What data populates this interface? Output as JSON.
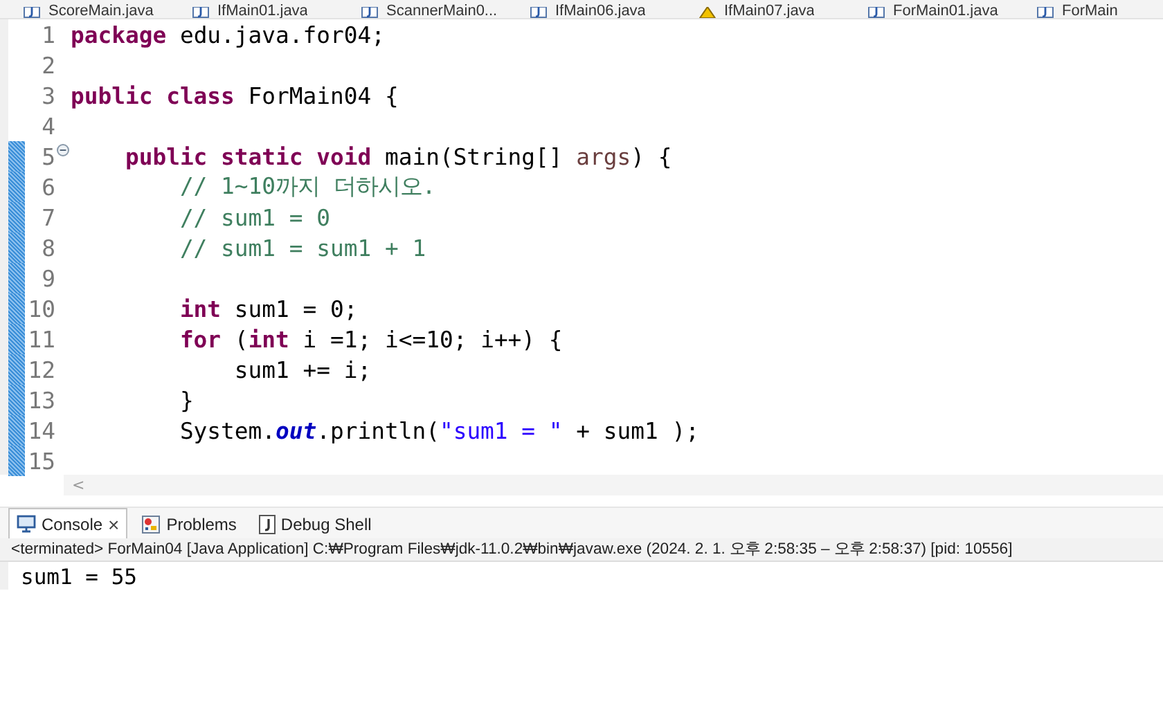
{
  "editor_tabs": [
    {
      "label": "ScoreMain.java",
      "kind": "java"
    },
    {
      "label": "IfMain01.java",
      "kind": "java"
    },
    {
      "label": "ScannerMain0...",
      "kind": "java"
    },
    {
      "label": "IfMain06.java",
      "kind": "java"
    },
    {
      "label": "IfMain07.java",
      "kind": "warning"
    },
    {
      "label": "ForMain01.java",
      "kind": "java"
    },
    {
      "label": "ForMain",
      "kind": "java"
    }
  ],
  "code_lines": [
    {
      "number": "1",
      "changed": false,
      "fold": false,
      "tokens": [
        {
          "kind": "keyword",
          "text": "package"
        },
        {
          "kind": "plain",
          "text": " edu.java.for04;"
        }
      ]
    },
    {
      "number": "2",
      "changed": false,
      "fold": false
    },
    {
      "number": "3",
      "changed": false,
      "fold": false,
      "tokens": [
        {
          "kind": "keyword",
          "text": "public class"
        },
        {
          "kind": "plain",
          "text": " ForMain04 {"
        }
      ]
    },
    {
      "number": "4",
      "changed": false,
      "fold": false
    },
    {
      "number": "5",
      "changed": true,
      "fold": true,
      "tokens": [
        {
          "kind": "keyword",
          "text": "    public static void"
        },
        {
          "kind": "plain",
          "text": " main(String[] "
        },
        {
          "kind": "variable",
          "text": "args"
        },
        {
          "kind": "plain",
          "text": ") {"
        }
      ]
    },
    {
      "number": "6",
      "changed": true,
      "fold": false,
      "tokens": [
        {
          "kind": "comment",
          "text": "        // 1~10까지 더하시오."
        }
      ]
    },
    {
      "number": "7",
      "changed": true,
      "fold": false,
      "tokens": [
        {
          "kind": "comment",
          "text": "        // sum1 = 0"
        }
      ]
    },
    {
      "number": "8",
      "changed": true,
      "fold": false,
      "tokens": [
        {
          "kind": "comment",
          "text": "        // sum1 = sum1 + 1"
        }
      ]
    },
    {
      "number": "9",
      "changed": true,
      "fold": false
    },
    {
      "number": "10",
      "changed": true,
      "fold": false,
      "tokens": [
        {
          "kind": "keyword",
          "text": "        int"
        },
        {
          "kind": "plain",
          "text": " sum1 = 0;"
        }
      ]
    },
    {
      "number": "11",
      "changed": true,
      "fold": false,
      "tokens": [
        {
          "kind": "keyword",
          "text": "        for"
        },
        {
          "kind": "plain",
          "text": " ("
        },
        {
          "kind": "keyword",
          "text": "int"
        },
        {
          "kind": "plain",
          "text": " i =1; i<=10; i++) {"
        }
      ]
    },
    {
      "number": "12",
      "changed": true,
      "fold": false,
      "tokens": [
        {
          "kind": "plain",
          "text": "            sum1 += i;"
        }
      ]
    },
    {
      "number": "13",
      "changed": true,
      "fold": false,
      "tokens": [
        {
          "kind": "plain",
          "text": "        }"
        }
      ]
    },
    {
      "number": "14",
      "changed": true,
      "fold": false,
      "tokens": [
        {
          "kind": "plain",
          "text": "        System."
        },
        {
          "kind": "field",
          "text": "out"
        },
        {
          "kind": "plain",
          "text": ".println("
        },
        {
          "kind": "string",
          "text": "\"sum1 = \""
        },
        {
          "kind": "plain",
          "text": " + sum1 );"
        }
      ]
    },
    {
      "number": "15",
      "changed": true,
      "fold": false
    }
  ],
  "scroll_arrow": "<",
  "view_tabs": [
    {
      "label": "Console",
      "kind": "console",
      "selected": true,
      "close": "×"
    },
    {
      "label": "Problems",
      "kind": "problems",
      "selected": false
    },
    {
      "label": "Debug Shell",
      "kind": "debug",
      "selected": false
    }
  ],
  "console_header": "<terminated> ForMain04 [Java Application] C:₩Program Files₩jdk-11.0.2₩bin₩javaw.exe  (2024. 2. 1. 오후 2:58:35 – 오후 2:58:37) [pid: 10556]",
  "console_output": "sum1 = 55"
}
